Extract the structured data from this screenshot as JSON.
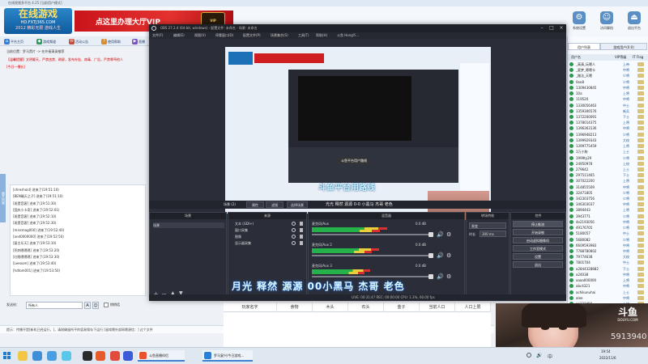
{
  "client": {
    "title": "在线视频多平台 4.25 [当前用户模式]",
    "logo": {
      "line1": "在线游戏",
      "line2": "HD.FXTJ365.COM",
      "line3": "2012 精彩无限 游戏人生"
    },
    "vip_banner": "点这里办理大厅VIP",
    "right_tools": [
      "系统设置",
      "访问聊档",
      "退出平台"
    ],
    "toolbar": [
      {
        "label": "平台主页",
        "color": "#3b7fd1"
      },
      {
        "label": "游戏频道",
        "color": "#2e9b5c"
      },
      {
        "label": "活动公告",
        "color": "#c84a3a"
      },
      {
        "label": "使用帮助",
        "color": "#d88c2a"
      },
      {
        "label": "直播",
        "color": "#7a52c2"
      }
    ],
    "current_channel": "当前位置：罗马黑片 -> 在外接演录推荐",
    "announcement": "【温馨提醒】文明聊天，严禁违禁、刷屏，发布外挂、病毒、广告，严禁辱骂他人",
    "announcement2": "[今日一播长]",
    "side_tab": "展开列表",
    "chat_lines": [
      "[shreshoid] 进来了(19:51:10)",
      "[BEN确天之子] 进来了(19:51:10)",
      "[斑提音客] 进来了(19:51:30)",
      "[国庆小卡奇] 进来了(19:52:01)",
      "[斑提音客] 进来了(19:52:10)",
      "[斑提音客] 进来了(19:52:30)",
      "[missmag000] 进来了(19:52:40)",
      "[and0000000] 进来了(19:52:50)",
      "[复古乐天] 进来了(19:53:10)",
      "[死刺嗯嗯嗯] 进来了(19:53:20)",
      "[红眼嗯嗯嗯] 进来了(19:53:30)",
      "[Leeoom] 进来了(19:53:40)",
      "[hdtom001] 进来了(19:53:50)"
    ],
    "send_label": "发送给：",
    "send_target": "所有人",
    "secret_label": "悄悄话",
    "hint": "提示：传播不是[新机已经运行，]，请耐确留所平的容易保存下运行 [留戏嗯外部网嗯源信：] 过个文件",
    "sidebar_tabs": [
      "用户列表",
      "游戏用户(0:0)"
    ],
    "user_head": [
      "用户名",
      "VIP等级",
      "IT Flag"
    ],
    "users": [
      [
        "_高清_玩嗯人",
        "上帝"
      ],
      [
        "_夏梦_嗯嗯卡",
        "中将"
      ],
      [
        "_路法_天嗯",
        "少将"
      ],
      [
        "0oo8",
        "少将"
      ],
      [
        "1309430845",
        "中将"
      ],
      [
        "10a",
        "上将"
      ],
      [
        "119520",
        "中将"
      ],
      [
        "1330056463",
        "中士"
      ],
      [
        "1359306576",
        "新兵"
      ],
      [
        "1372200091",
        "下士"
      ],
      [
        "1378014375",
        "上将"
      ],
      [
        "1396363136",
        "中将"
      ],
      [
        "1396948213",
        "少将"
      ],
      [
        "1399929343",
        "大校"
      ],
      [
        "1399775459",
        "上将"
      ],
      [
        "1万小狗",
        "上士"
      ],
      [
        "1999ty29",
        "少将"
      ],
      [
        "24950978",
        "上校"
      ],
      [
        "279642",
        "上士"
      ],
      [
        "297511465",
        "下士"
      ],
      [
        "307022200",
        "上将"
      ],
      [
        "314855509",
        "中将"
      ],
      [
        "32471805",
        "少将"
      ],
      [
        "342303756",
        "少将"
      ],
      [
        "346303037",
        "中将"
      ],
      [
        "3894443",
        "上将"
      ],
      [
        "3943771",
        "少将"
      ],
      [
        "4e2193056",
        "中将"
      ],
      [
        "49176705",
        "少将"
      ],
      [
        "5180057",
        "中士"
      ],
      [
        "5680082",
        "少将"
      ],
      [
        "6609593983",
        "中将"
      ],
      [
        "7788780802",
        "中将"
      ],
      [
        "79774638",
        "大校"
      ],
      [
        "7801704",
        "中士"
      ],
      [
        "a2844328882",
        "下士"
      ],
      [
        "a24038",
        "中将"
      ],
      [
        "aaaa000000",
        "上将"
      ],
      [
        "abc4321",
        "中将"
      ],
      [
        "achikunuhai",
        "上士"
      ],
      [
        "alee",
        "中将"
      ],
      [
        "ao123456",
        "上校"
      ]
    ],
    "sheet_columns": [
      "玩家名字",
      "食物",
      "木头",
      "石头",
      "金子",
      "当前人口",
      "人口上限"
    ]
  },
  "obs": {
    "title": "OBS 27.2.4 (64-bit, windows) - 配置文件: 未命名 - 场景: 未命名",
    "menu": [
      "文件(F)",
      "编辑(E)",
      "视图(V)",
      "停靠窗口(D)",
      "配置文件(P)",
      "场景集合(S)",
      "工具(T)",
      "帮助(H)",
      "斗鱼 HongYi..."
    ],
    "current_scene": "场景 (2)",
    "scene_buttons": [
      "属性",
      "滤镜"
    ],
    "studio_buttons": [
      "选择场景",
      "选择场景"
    ],
    "stream_title": "光光  释然  源源  0-0  小黑马  杰哥  老色",
    "preview_caption": "斗鱼平台用路线",
    "preview_label": "斗鱼平台用户路线",
    "docks": {
      "scenes": "场景",
      "sources": "来源",
      "mixer": "混音器",
      "transitions": "转场特效",
      "controls": "控件"
    },
    "scenes": [
      "场景"
    ],
    "sources": [
      "文本 (GDI+)",
      "窗口采集",
      "图像",
      "显示器采集"
    ],
    "mixer": [
      {
        "name": "麦克风/Aux",
        "db": "0.0 dB",
        "level": 0.62
      },
      {
        "name": "麦克风/Aux 2",
        "db": "0.0 dB",
        "level": 0.55
      },
      {
        "name": "麦克风/Aux 3",
        "db": "0.0 dB",
        "level": 0.48
      }
    ],
    "transition": {
      "type": "渐变",
      "duration_label": "时长",
      "duration": "300 ms"
    },
    "controls": [
      "停止推流",
      "开始录制",
      "启动虚拟摄像机",
      "工作室模式",
      "设置",
      "退出"
    ],
    "caption": "月光  释然  源源  00小黑马  杰哥  老色",
    "status": "LIVE: 00:31:47     REC: 00:00:00     CPU: 1.3%, 60.00 fps"
  },
  "webcam": {
    "logo": "斗鱼",
    "logo_sub": "DOUYU.COM",
    "room_id": "5913940"
  },
  "taskbar": {
    "apps": [
      {
        "label": "斗鱼直播伴侣",
        "color": "#e9542e"
      },
      {
        "label": "罗马复兴/今日游戏...",
        "color": "#2d7fd3"
      }
    ],
    "time": "19:54",
    "date": "2022/11/6"
  }
}
